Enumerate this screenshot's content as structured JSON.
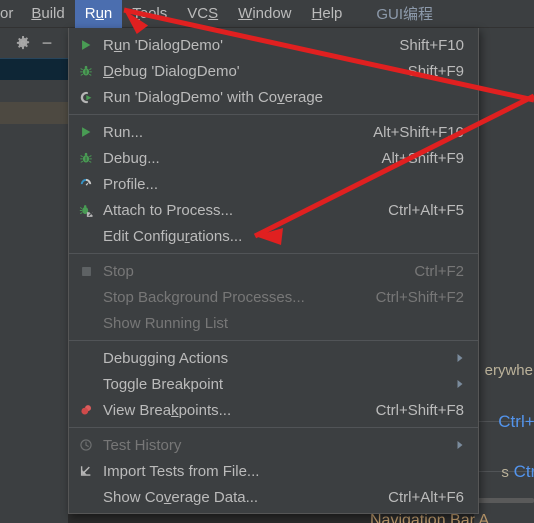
{
  "menubar": {
    "items": [
      {
        "label": "or",
        "mnemonic": "",
        "clipped": true,
        "selected": false,
        "plugin": false
      },
      {
        "label": "Build",
        "mnemonic": "B",
        "clipped": false,
        "selected": false,
        "plugin": false
      },
      {
        "label": "Run",
        "mnemonic": "u",
        "clipped": false,
        "selected": true,
        "plugin": false
      },
      {
        "label": "Tools",
        "mnemonic": "T",
        "clipped": false,
        "selected": false,
        "plugin": false
      },
      {
        "label": "VCS",
        "mnemonic": "S",
        "clipped": false,
        "selected": false,
        "plugin": false
      },
      {
        "label": "Window",
        "mnemonic": "W",
        "clipped": false,
        "selected": false,
        "plugin": false
      },
      {
        "label": "Help",
        "mnemonic": "H",
        "clipped": false,
        "selected": false,
        "plugin": false
      },
      {
        "label": "GUI编程",
        "mnemonic": "",
        "clipped": false,
        "selected": false,
        "plugin": true
      }
    ]
  },
  "run_menu": {
    "groups": [
      {
        "items": [
          {
            "icon": "run-green-arrow-icon",
            "label": "Run 'DialogDemo'",
            "mnemonic": "u",
            "shortcut": "Shift+F10",
            "disabled": false,
            "submenu": false
          },
          {
            "icon": "debug-bug-icon",
            "label": "Debug 'DialogDemo'",
            "mnemonic": "D",
            "shortcut": "Shift+F9",
            "disabled": false,
            "submenu": false
          },
          {
            "icon": "run-with-coverage-icon",
            "label": "Run 'DialogDemo' with Coverage",
            "mnemonic": "v",
            "shortcut": "",
            "disabled": false,
            "submenu": false
          }
        ]
      },
      {
        "items": [
          {
            "icon": "run-green-arrow-icon",
            "label": "Run...",
            "mnemonic": "",
            "shortcut": "Alt+Shift+F10",
            "disabled": false,
            "submenu": false
          },
          {
            "icon": "debug-bug-icon",
            "label": "Debug...",
            "mnemonic": "",
            "shortcut": "Alt+Shift+F9",
            "disabled": false,
            "submenu": false
          },
          {
            "icon": "profile-gauge-icon",
            "label": "Profile...",
            "mnemonic": "",
            "shortcut": "",
            "disabled": false,
            "submenu": false
          },
          {
            "icon": "attach-process-icon",
            "label": "Attach to Process...",
            "mnemonic": "",
            "shortcut": "Ctrl+Alt+F5",
            "disabled": false,
            "submenu": false
          },
          {
            "icon": "none",
            "label": "Edit Configurations...",
            "mnemonic": "r",
            "shortcut": "",
            "disabled": false,
            "submenu": false
          }
        ]
      },
      {
        "items": [
          {
            "icon": "stop-square-icon",
            "label": "Stop",
            "mnemonic": "",
            "shortcut": "Ctrl+F2",
            "disabled": true,
            "submenu": false
          },
          {
            "icon": "none",
            "label": "Stop Background Processes...",
            "mnemonic": "",
            "shortcut": "Ctrl+Shift+F2",
            "disabled": true,
            "submenu": false
          },
          {
            "icon": "none",
            "label": "Show Running List",
            "mnemonic": "",
            "shortcut": "",
            "disabled": true,
            "submenu": false
          }
        ]
      },
      {
        "items": [
          {
            "icon": "none",
            "label": "Debugging Actions",
            "mnemonic": "",
            "shortcut": "",
            "disabled": false,
            "submenu": true
          },
          {
            "icon": "none",
            "label": "Toggle Breakpoint",
            "mnemonic": "",
            "shortcut": "",
            "disabled": false,
            "submenu": true
          },
          {
            "icon": "breakpoints-icon",
            "label": "View Breakpoints...",
            "mnemonic": "k",
            "shortcut": "Ctrl+Shift+F8",
            "disabled": false,
            "submenu": false
          }
        ]
      },
      {
        "items": [
          {
            "icon": "test-history-clock-icon",
            "label": "Test History",
            "mnemonic": "",
            "shortcut": "",
            "disabled": true,
            "submenu": true
          },
          {
            "icon": "import-tests-icon",
            "label": "Import Tests from File...",
            "mnemonic": "",
            "shortcut": "",
            "disabled": false,
            "submenu": false
          },
          {
            "icon": "none",
            "label": "Show Coverage Data...",
            "mnemonic": "v",
            "shortcut": "Ctrl+Alt+F6",
            "disabled": false,
            "submenu": false
          }
        ]
      }
    ]
  },
  "toolwindow": {
    "gear_icon": "gear-icon",
    "minimize_icon": "minimize-icon"
  },
  "background": {
    "text_everywhere": "erywher",
    "text_ctrl_s_1": "Ctrl+S",
    "text_s_prefix": "s",
    "text_ctrl_2": "Ctrl+",
    "text_navigation_bar": "Navigation Bar   A"
  },
  "colors": {
    "menu_bg": "#3c3f41",
    "editor_bg": "#2b2b2b",
    "selection_blue": "#4b6eaf",
    "text": "#bbbbbb",
    "disabled_text": "#777777",
    "accent_green": "#499c54",
    "arrow_red": "#e02020",
    "link_blue": "#5394ec"
  }
}
